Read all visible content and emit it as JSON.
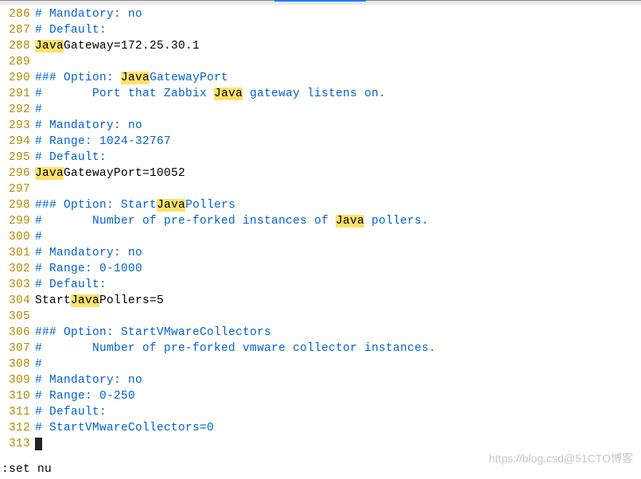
{
  "lines": [
    {
      "num": "286",
      "tokens": [
        {
          "t": "#",
          "c": "comment"
        },
        {
          "t": " ",
          "c": "comment"
        },
        {
          "t": "Mandatory: no",
          "c": "comment"
        }
      ]
    },
    {
      "num": "287",
      "tokens": [
        {
          "t": "#",
          "c": "comment"
        },
        {
          "t": " ",
          "c": "comment"
        },
        {
          "t": "Default:",
          "c": "comment"
        }
      ]
    },
    {
      "num": "288",
      "tokens": [
        {
          "t": "Java",
          "c": "hl"
        },
        {
          "t": "Gateway=172.25.30.1",
          "c": "normal"
        }
      ]
    },
    {
      "num": "289",
      "tokens": []
    },
    {
      "num": "290",
      "tokens": [
        {
          "t": "###",
          "c": "comment"
        },
        {
          "t": " ",
          "c": "comment"
        },
        {
          "t": "Option: ",
          "c": "comment"
        },
        {
          "t": "Java",
          "c": "hl"
        },
        {
          "t": "GatewayPort",
          "c": "comment"
        }
      ]
    },
    {
      "num": "291",
      "tokens": [
        {
          "t": "#",
          "c": "comment"
        },
        {
          "t": "       ",
          "c": "comment"
        },
        {
          "t": "Port that Zabbix ",
          "c": "comment"
        },
        {
          "t": "Java",
          "c": "hl"
        },
        {
          "t": " gateway listens on.",
          "c": "comment"
        }
      ]
    },
    {
      "num": "292",
      "tokens": [
        {
          "t": "#",
          "c": "comment"
        }
      ]
    },
    {
      "num": "293",
      "tokens": [
        {
          "t": "#",
          "c": "comment"
        },
        {
          "t": " ",
          "c": "comment"
        },
        {
          "t": "Mandatory: no",
          "c": "comment"
        }
      ]
    },
    {
      "num": "294",
      "tokens": [
        {
          "t": "#",
          "c": "comment"
        },
        {
          "t": " ",
          "c": "comment"
        },
        {
          "t": "Range: 1024-32767",
          "c": "comment"
        }
      ]
    },
    {
      "num": "295",
      "tokens": [
        {
          "t": "#",
          "c": "comment"
        },
        {
          "t": " ",
          "c": "comment"
        },
        {
          "t": "Default:",
          "c": "comment"
        }
      ]
    },
    {
      "num": "296",
      "tokens": [
        {
          "t": "Java",
          "c": "hl"
        },
        {
          "t": "GatewayPort=10052",
          "c": "normal"
        }
      ]
    },
    {
      "num": "297",
      "tokens": []
    },
    {
      "num": "298",
      "tokens": [
        {
          "t": "###",
          "c": "comment"
        },
        {
          "t": " ",
          "c": "comment"
        },
        {
          "t": "Option: Start",
          "c": "comment"
        },
        {
          "t": "Java",
          "c": "hl"
        },
        {
          "t": "Pollers",
          "c": "comment"
        }
      ]
    },
    {
      "num": "299",
      "tokens": [
        {
          "t": "#",
          "c": "comment"
        },
        {
          "t": "       ",
          "c": "comment"
        },
        {
          "t": "Number of pre-forked instances of ",
          "c": "comment"
        },
        {
          "t": "Java",
          "c": "hl"
        },
        {
          "t": " pollers.",
          "c": "comment"
        }
      ]
    },
    {
      "num": "300",
      "tokens": [
        {
          "t": "#",
          "c": "comment"
        }
      ]
    },
    {
      "num": "301",
      "tokens": [
        {
          "t": "#",
          "c": "comment"
        },
        {
          "t": " ",
          "c": "comment"
        },
        {
          "t": "Mandatory: no",
          "c": "comment"
        }
      ]
    },
    {
      "num": "302",
      "tokens": [
        {
          "t": "#",
          "c": "comment"
        },
        {
          "t": " ",
          "c": "comment"
        },
        {
          "t": "Range: 0-1000",
          "c": "comment"
        }
      ]
    },
    {
      "num": "303",
      "tokens": [
        {
          "t": "#",
          "c": "comment"
        },
        {
          "t": " ",
          "c": "comment"
        },
        {
          "t": "Default:",
          "c": "comment"
        }
      ]
    },
    {
      "num": "304",
      "tokens": [
        {
          "t": "Start",
          "c": "normal"
        },
        {
          "t": "Java",
          "c": "hl"
        },
        {
          "t": "Pollers=5",
          "c": "normal"
        }
      ]
    },
    {
      "num": "305",
      "tokens": []
    },
    {
      "num": "306",
      "tokens": [
        {
          "t": "###",
          "c": "comment"
        },
        {
          "t": " ",
          "c": "comment"
        },
        {
          "t": "Option: StartVMwareCollectors",
          "c": "comment"
        }
      ]
    },
    {
      "num": "307",
      "tokens": [
        {
          "t": "#",
          "c": "comment"
        },
        {
          "t": "       ",
          "c": "comment"
        },
        {
          "t": "Number of pre-forked vmware collector instances.",
          "c": "comment"
        }
      ]
    },
    {
      "num": "308",
      "tokens": [
        {
          "t": "#",
          "c": "comment"
        }
      ]
    },
    {
      "num": "309",
      "tokens": [
        {
          "t": "#",
          "c": "comment"
        },
        {
          "t": " ",
          "c": "comment"
        },
        {
          "t": "Mandatory: no",
          "c": "comment"
        }
      ]
    },
    {
      "num": "310",
      "tokens": [
        {
          "t": "#",
          "c": "comment"
        },
        {
          "t": " ",
          "c": "comment"
        },
        {
          "t": "Range: 0-250",
          "c": "comment"
        }
      ]
    },
    {
      "num": "311",
      "tokens": [
        {
          "t": "#",
          "c": "comment"
        },
        {
          "t": " ",
          "c": "comment"
        },
        {
          "t": "Default:",
          "c": "comment"
        }
      ]
    },
    {
      "num": "312",
      "tokens": [
        {
          "t": "#",
          "c": "comment"
        },
        {
          "t": " ",
          "c": "comment"
        },
        {
          "t": "StartVMwareCollectors=0",
          "c": "comment"
        }
      ]
    },
    {
      "num": "313",
      "tokens": [
        {
          "t": "__CURSOR__",
          "c": "normal"
        }
      ]
    }
  ],
  "status": ":set nu",
  "watermark": "https://blog.csd@51CTO博客"
}
